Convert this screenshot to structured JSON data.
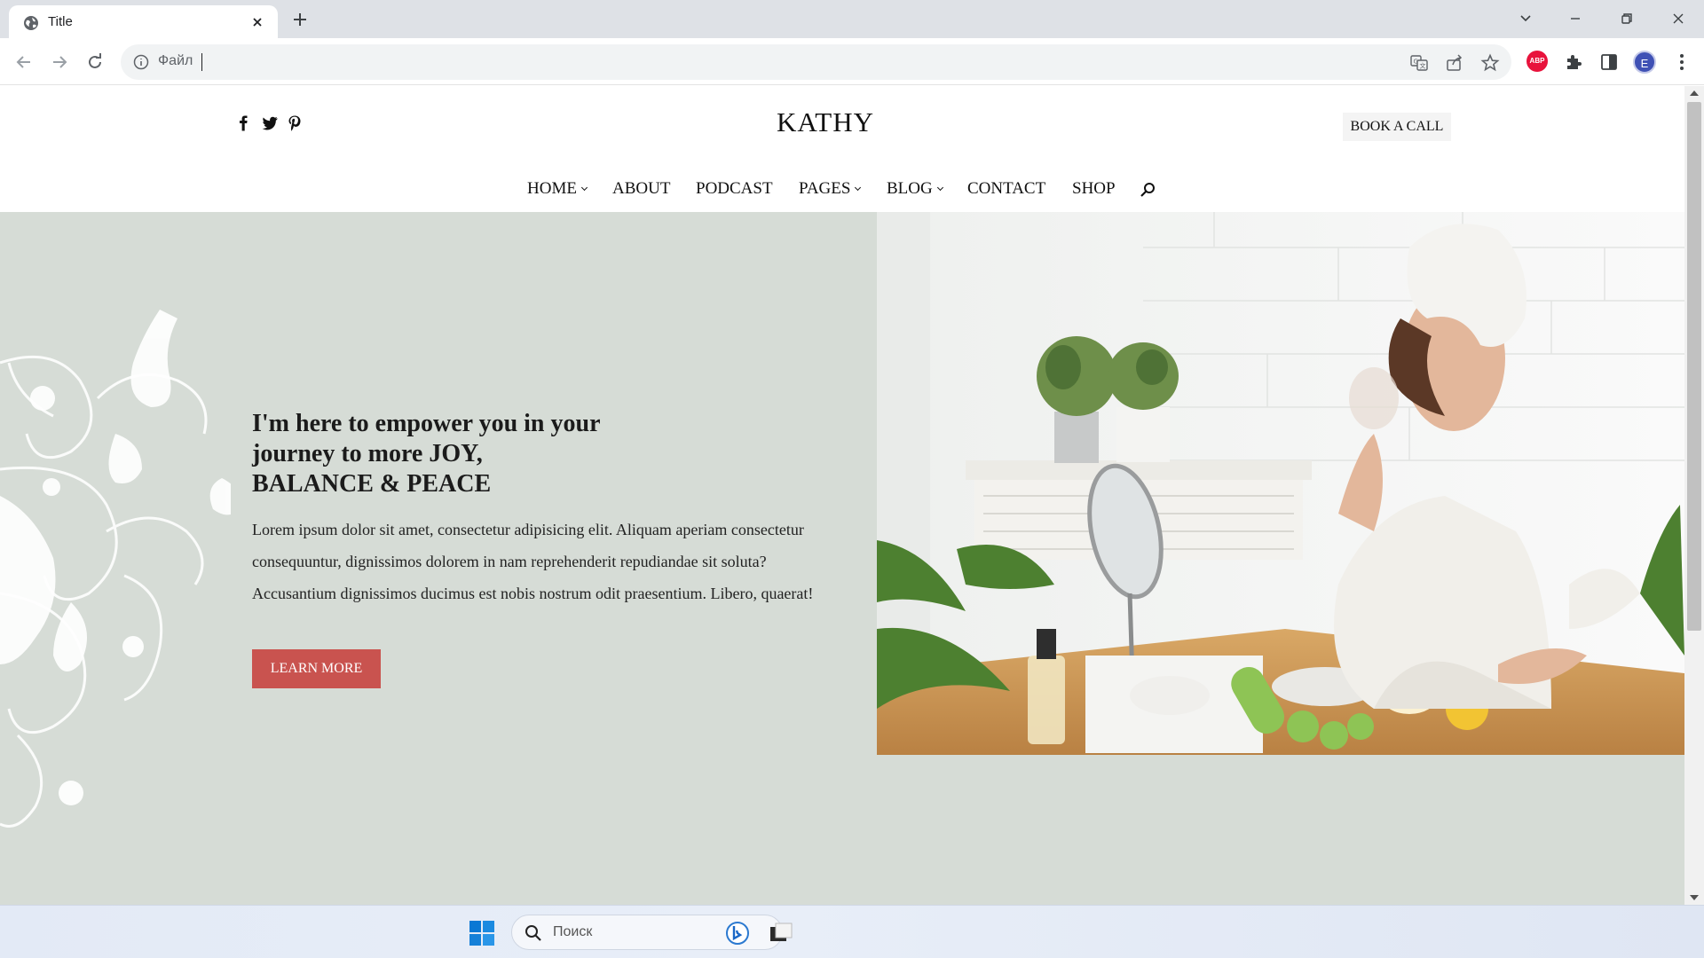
{
  "browser": {
    "tab_title": "Title",
    "address_text": "Файл",
    "profile_initial": "E",
    "extension_label": "ABP"
  },
  "site": {
    "brand": "KATHY",
    "book_call_label": "BOOK A CALL",
    "social_icons": [
      "facebook-icon",
      "twitter-icon",
      "pinterest-icon"
    ],
    "nav": [
      {
        "label": "HOME",
        "has_dropdown": true
      },
      {
        "label": "ABOUT",
        "has_dropdown": false
      },
      {
        "label": "PODCAST",
        "has_dropdown": false
      },
      {
        "label": "PAGES",
        "has_dropdown": true
      },
      {
        "label": "BLOG",
        "has_dropdown": true
      },
      {
        "label": "CONTACT",
        "has_dropdown": false
      },
      {
        "label": "SHOP",
        "has_dropdown": false
      }
    ]
  },
  "hero": {
    "title_line1": "I'm here to empower you in your",
    "title_line2": "journey to more JOY,",
    "title_line3": "BALANCE & PEACE",
    "body": "Lorem ipsum dolor sit amet, consectetur adipisicing elit. Aliquam aperiam consectetur consequuntur, dignissimos dolorem in nam reprehenderit repudiandae sit soluta? Accusantium dignissimos ducimus est nobis nostrum odit praesentium. Libero, quaerat!",
    "button_label": "LEARN MORE",
    "background_color": "#d6dcd6",
    "button_color": "#c9534f"
  },
  "taskbar": {
    "search_placeholder": "Поиск"
  }
}
